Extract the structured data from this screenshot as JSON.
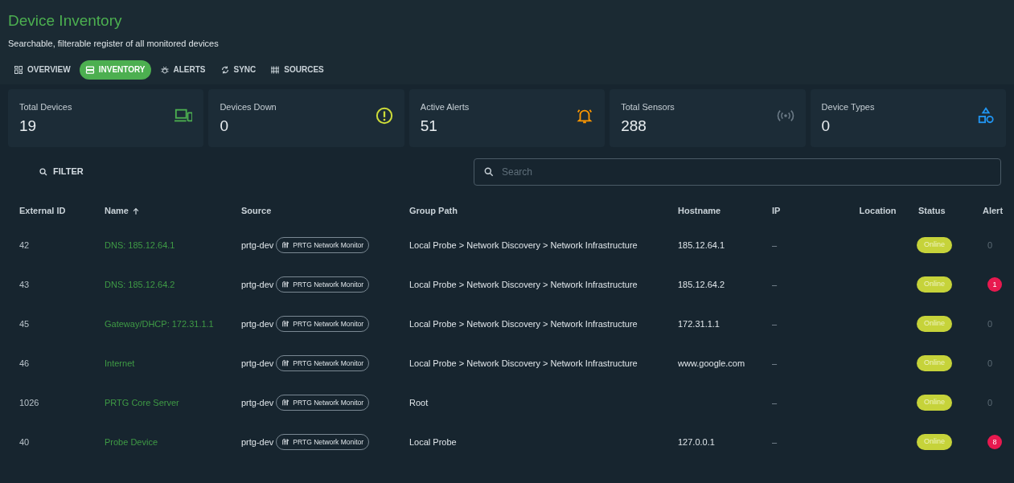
{
  "header": {
    "title": "Device Inventory",
    "subtitle": "Searchable, filterable register of all monitored devices"
  },
  "tabs": [
    {
      "label": "OVERVIEW",
      "selected": false
    },
    {
      "label": "INVENTORY",
      "selected": true
    },
    {
      "label": "ALERTS",
      "selected": false
    },
    {
      "label": "SYNC",
      "selected": false
    },
    {
      "label": "SOURCES",
      "selected": false
    }
  ],
  "stats": [
    {
      "label": "Total Devices",
      "value": "19",
      "color": "#4caf50"
    },
    {
      "label": "Devices Down",
      "value": "0",
      "color": "#cddc39"
    },
    {
      "label": "Active Alerts",
      "value": "51",
      "color": "#ff9800"
    },
    {
      "label": "Total Sensors",
      "value": "288",
      "color": "#6b7a86"
    },
    {
      "label": "Device Types",
      "value": "0",
      "color": "#2196f3"
    }
  ],
  "filter_button": "FILTER",
  "search": {
    "placeholder": "Search"
  },
  "table": {
    "columns": [
      {
        "label": "External ID",
        "sorted": false
      },
      {
        "label": "Name",
        "sorted": true
      },
      {
        "label": "Source",
        "sorted": false
      },
      {
        "label": "Group Path",
        "sorted": false
      },
      {
        "label": "Hostname",
        "sorted": false
      },
      {
        "label": "IP",
        "sorted": false
      },
      {
        "label": "Location",
        "sorted": false
      },
      {
        "label": "Status",
        "sorted": false
      },
      {
        "label": "Alert",
        "sorted": false
      }
    ],
    "rows": [
      {
        "external_id": "42",
        "name": "DNS: 185.12.64.1",
        "source": "prtg-dev",
        "source_chip": "PRTG Network Monitor",
        "group_path": "Local Probe > Network Discovery > Network Infrastructure",
        "hostname": "185.12.64.1",
        "ip": "–",
        "status": "Online",
        "alerts": "0",
        "alert_badge": false
      },
      {
        "external_id": "43",
        "name": "DNS: 185.12.64.2",
        "source": "prtg-dev",
        "source_chip": "PRTG Network Monitor",
        "group_path": "Local Probe > Network Discovery > Network Infrastructure",
        "hostname": "185.12.64.2",
        "ip": "–",
        "status": "Online",
        "alerts": "1",
        "alert_badge": true
      },
      {
        "external_id": "45",
        "name": "Gateway/DHCP: 172.31.1.1",
        "source": "prtg-dev",
        "source_chip": "PRTG Network Monitor",
        "group_path": "Local Probe > Network Discovery > Network Infrastructure",
        "hostname": "172.31.1.1",
        "ip": "–",
        "status": "Online",
        "alerts": "0",
        "alert_badge": false
      },
      {
        "external_id": "46",
        "name": "Internet",
        "source": "prtg-dev",
        "source_chip": "PRTG Network Monitor",
        "group_path": "Local Probe > Network Discovery > Network Infrastructure",
        "hostname": "www.google.com",
        "ip": "–",
        "status": "Online",
        "alerts": "0",
        "alert_badge": false
      },
      {
        "external_id": "1026",
        "name": "PRTG Core Server",
        "source": "prtg-dev",
        "source_chip": "PRTG Network Monitor",
        "group_path": "Root",
        "ip": "–",
        "status": "Online",
        "alerts": "0",
        "alert_badge": false
      },
      {
        "external_id": "40",
        "name": "Probe Device",
        "source": "prtg-dev",
        "source_chip": "PRTG Network Monitor",
        "group_path": "Local Probe",
        "hostname": "127.0.0.1",
        "ip": "–",
        "status": "Online",
        "alerts": "8",
        "alert_badge": true
      }
    ]
  }
}
